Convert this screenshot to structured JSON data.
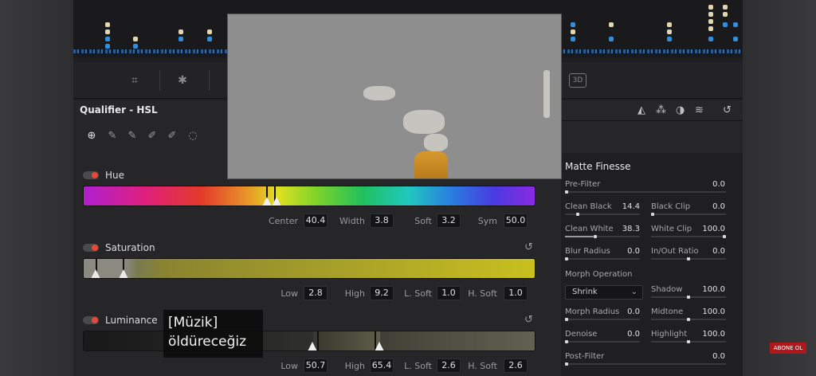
{
  "qualifier": {
    "title": "Qualifier - HSL",
    "hue": {
      "label": "Hue",
      "center_label": "Center",
      "center": "40.4",
      "width_label": "Width",
      "width": "3.8",
      "soft_label": "Soft",
      "soft": "3.2",
      "sym_label": "Sym",
      "sym": "50.0"
    },
    "saturation": {
      "label": "Saturation",
      "low_label": "Low",
      "low": "2.8",
      "high_label": "High",
      "high": "9.2",
      "lsoft_label": "L. Soft",
      "lsoft": "1.0",
      "hsoft_label": "H. Soft",
      "hsoft": "1.0"
    },
    "luminance": {
      "label": "Luminance",
      "low_label": "Low",
      "low": "50.7",
      "high_label": "High",
      "high": "65.4",
      "lsoft_label": "L. Soft",
      "lsoft": "2.6",
      "hsoft_label": "H. Soft",
      "hsoft": "2.6"
    }
  },
  "matte_finesse": {
    "title": "Matte Finesse",
    "pre_filter": {
      "label": "Pre-Filter",
      "value": "0.0"
    },
    "clean_black": {
      "label": "Clean Black",
      "value": "14.4"
    },
    "black_clip": {
      "label": "Black Clip",
      "value": "0.0"
    },
    "clean_white": {
      "label": "Clean White",
      "value": "38.3"
    },
    "white_clip": {
      "label": "White Clip",
      "value": "100.0"
    },
    "blur_radius": {
      "label": "Blur Radius",
      "value": "0.0"
    },
    "in_out_ratio": {
      "label": "In/Out Ratio",
      "value": "0.0"
    },
    "morph_operation": {
      "label": "Morph Operation",
      "value": "Shrink"
    },
    "shadow": {
      "label": "Shadow",
      "value": "100.0"
    },
    "morph_radius": {
      "label": "Morph Radius",
      "value": "0.0"
    },
    "midtone": {
      "label": "Midtone",
      "value": "100.0"
    },
    "denoise": {
      "label": "Denoise",
      "value": "0.0"
    },
    "highlight": {
      "label": "Highlight",
      "value": "100.0"
    },
    "post_filter": {
      "label": "Post-Filter",
      "value": "0.0"
    }
  },
  "toolbar": {
    "label_3d": "3D"
  },
  "subtitle": {
    "line1": "[Müzik]",
    "line2": "öldüreceğiz"
  },
  "badge": {
    "text": "ABONE OL"
  },
  "colors": {
    "toggle_red": "#e8463a",
    "accent_blue": "#2f8fe0"
  }
}
